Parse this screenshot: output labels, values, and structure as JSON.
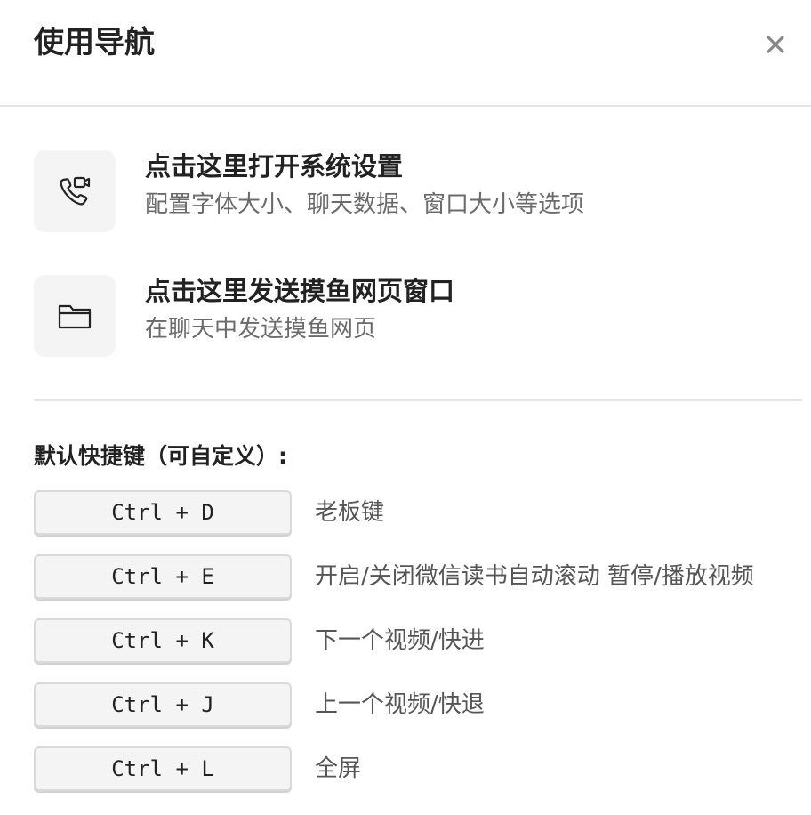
{
  "header": {
    "title": "使用导航",
    "close_icon": "close-icon"
  },
  "nav_items": [
    {
      "icon": "video-call-icon",
      "title": "点击这里打开系统设置",
      "description": "配置字体大小、聊天数据、窗口大小等选项"
    },
    {
      "icon": "folder-icon",
      "title": "点击这里发送摸鱼网页窗口",
      "description": "在聊天中发送摸鱼网页"
    }
  ],
  "shortcuts": {
    "heading": "默认快捷键（可自定义）:",
    "items": [
      {
        "keys": "Ctrl + D",
        "description": "老板键"
      },
      {
        "keys": "Ctrl + E",
        "description": "开启/关闭微信读书自动滚动 暂停/播放视频"
      },
      {
        "keys": "Ctrl + K",
        "description": "下一个视频/快进"
      },
      {
        "keys": "Ctrl + J",
        "description": "上一个视频/快退"
      },
      {
        "keys": "Ctrl + L",
        "description": "全屏"
      }
    ]
  },
  "colors": {
    "text": "#222222",
    "secondary_text": "#6b6b6b",
    "divider": "#e5e5e5",
    "icon_bg": "#f4f4f4"
  }
}
